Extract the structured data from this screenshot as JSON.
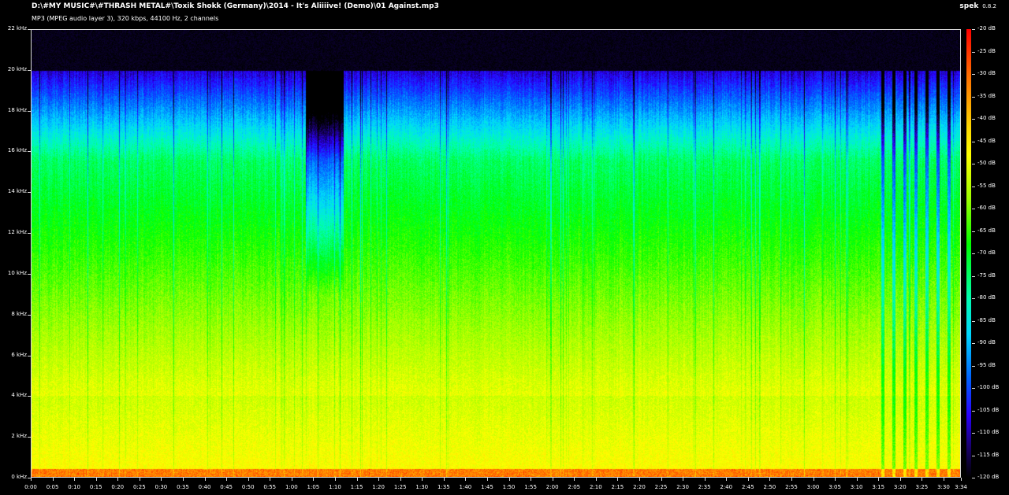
{
  "header": {
    "file_path": "D:\\#MY MUSIC#\\#THRASH METAL#\\Toxik Shokk (Germany)\\2014 - It's Aliiiive! (Demo)\\01 Against.mp3",
    "stream_info": "MP3 (MPEG audio layer 3), 320 kbps, 44100 Hz, 2 channels",
    "app_name": "spek",
    "app_version": "0.8.2"
  },
  "colors": {
    "background": "#000000",
    "frame": "#d8d8d8",
    "text": "#ffffff"
  },
  "chart_data": {
    "type": "heatmap",
    "y_axis": {
      "labels": [
        "22 kHz",
        "20 kHz",
        "18 kHz",
        "16 kHz",
        "14 kHz",
        "12 kHz",
        "10 kHz",
        "8 kHz",
        "6 kHz",
        "4 kHz",
        "2 kHz",
        "0 kHz"
      ],
      "values": [
        22,
        20,
        18,
        16,
        14,
        12,
        10,
        8,
        6,
        4,
        2,
        0
      ],
      "range": [
        0,
        22
      ]
    },
    "x_axis": {
      "labels": [
        "0:00",
        "0:05",
        "0:10",
        "0:15",
        "0:20",
        "0:25",
        "0:30",
        "0:35",
        "0:40",
        "0:45",
        "0:50",
        "0:55",
        "1:00",
        "1:05",
        "1:10",
        "1:15",
        "1:20",
        "1:25",
        "1:30",
        "1:35",
        "1:40",
        "1:45",
        "1:50",
        "1:55",
        "2:00",
        "2:05",
        "2:10",
        "2:15",
        "2:20",
        "2:25",
        "2:30",
        "2:35",
        "2:40",
        "2:45",
        "2:50",
        "2:55",
        "3:00",
        "3:05",
        "3:10",
        "3:15",
        "3:20",
        "3:25",
        "3:30",
        "3:34"
      ],
      "seconds": [
        0,
        5,
        10,
        15,
        20,
        25,
        30,
        35,
        40,
        45,
        50,
        55,
        60,
        65,
        70,
        75,
        80,
        85,
        90,
        95,
        100,
        105,
        110,
        115,
        120,
        125,
        130,
        135,
        140,
        145,
        150,
        155,
        160,
        165,
        170,
        175,
        180,
        185,
        190,
        195,
        200,
        205,
        210,
        214
      ],
      "range": [
        0,
        214
      ]
    },
    "color_scale": {
      "labels": [
        "-20 dB",
        "-25 dB",
        "-30 dB",
        "-35 dB",
        "-40 dB",
        "-45 dB",
        "-50 dB",
        "-55 dB",
        "-60 dB",
        "-65 dB",
        "-70 dB",
        "-75 dB",
        "-80 dB",
        "-85 dB",
        "-90 dB",
        "-95 dB",
        "-100 dB",
        "-105 dB",
        "-110 dB",
        "-115 dB",
        "-120 dB"
      ],
      "values": [
        -20,
        -25,
        -30,
        -35,
        -40,
        -45,
        -50,
        -55,
        -60,
        -65,
        -70,
        -75,
        -80,
        -85,
        -90,
        -95,
        -100,
        -105,
        -110,
        -115,
        -120
      ],
      "range": [
        -120,
        -20
      ]
    },
    "cutoff_khz": 20
  }
}
